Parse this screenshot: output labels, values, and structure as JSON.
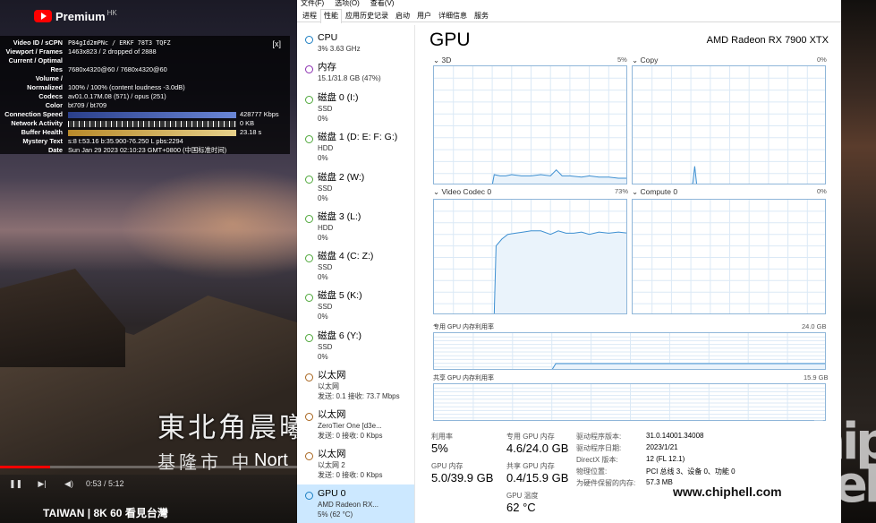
{
  "video": {
    "brand": "Premium",
    "region": "HK",
    "stats": [
      {
        "k": "Video ID / sCPN",
        "v": "P84gId2mPNc  /  ERKF  78T3  TQFZ"
      },
      {
        "k": "Viewport / Frames",
        "v": "1463x823 / 2 dropped of 2888"
      },
      {
        "k": "Current / Optimal",
        "v": ""
      },
      {
        "k": "Res",
        "v": "7680x4320@60 / 7680x4320@60"
      },
      {
        "k": "Volume /",
        "v": ""
      },
      {
        "k": "Normalized",
        "v": "100% / 100% (content loudness -3.0dB)"
      },
      {
        "k": "Codecs",
        "v": "av01.0.17M.08 (571) / opus (251)"
      },
      {
        "k": "Color",
        "v": "bt709 / bt709"
      },
      {
        "k": "Connection Speed",
        "v": "428777 Kbps"
      },
      {
        "k": "Network Activity",
        "v": "0 KB"
      },
      {
        "k": "Buffer Health",
        "v": "23.18 s"
      },
      {
        "k": "Mystery Text",
        "v": "s:8 t:53.16 b:35.900-76.250 L pbs:2294"
      },
      {
        "k": "Date",
        "v": "Sun Jan 29 2023 02:10:23 GMT+0800 (中国标准时间)"
      }
    ],
    "close_label": "[x]",
    "subtitle_cn": "東北角晨曦",
    "subtitle_city": "基隆市 中",
    "subtitle_en": "Nort",
    "time": "0:53 / 5:12",
    "progress": 0.17,
    "title": "TAIWAN | 8K 60 看見台灣"
  },
  "taskmgr": {
    "menu": [
      "文件(F)",
      "选项(O)",
      "查看(V)"
    ],
    "tabs": [
      "进程",
      "性能",
      "应用历史记录",
      "启动",
      "用户",
      "详细信息",
      "服务"
    ],
    "active_tab": 1,
    "sidebar": [
      {
        "name": "CPU",
        "sub1": "3%  3.63 GHz",
        "sub2": "",
        "color": "#1b7ec2"
      },
      {
        "name": "内存",
        "sub1": "15.1/31.8 GB (47%)",
        "sub2": "",
        "color": "#8b2fb0"
      },
      {
        "name": "磁盘 0 (I:)",
        "sub1": "SSD",
        "sub2": "0%",
        "color": "#4fa83a"
      },
      {
        "name": "磁盘 1 (D: E: F: G:)",
        "sub1": "HDD",
        "sub2": "0%",
        "color": "#4fa83a"
      },
      {
        "name": "磁盘 2 (W:)",
        "sub1": "SSD",
        "sub2": "0%",
        "color": "#4fa83a"
      },
      {
        "name": "磁盘 3 (L:)",
        "sub1": "HDD",
        "sub2": "0%",
        "color": "#4fa83a"
      },
      {
        "name": "磁盘 4 (C: Z:)",
        "sub1": "SSD",
        "sub2": "0%",
        "color": "#4fa83a"
      },
      {
        "name": "磁盘 5 (K:)",
        "sub1": "SSD",
        "sub2": "0%",
        "color": "#4fa83a"
      },
      {
        "name": "磁盘 6 (Y:)",
        "sub1": "SSD",
        "sub2": "0%",
        "color": "#4fa83a"
      },
      {
        "name": "以太网",
        "sub1": "以太网",
        "sub2": "发送: 0.1 接收: 73.7 Mbps",
        "color": "#a8651e"
      },
      {
        "name": "以太网",
        "sub1": "ZeroTier One [d3e...",
        "sub2": "发送: 0 接收: 0 Kbps",
        "color": "#a8651e"
      },
      {
        "name": "以太网",
        "sub1": "以太网 2",
        "sub2": "发送: 0 接收: 0 Kbps",
        "color": "#a8651e"
      },
      {
        "name": "GPU 0",
        "sub1": "AMD Radeon RX...",
        "sub2": "5% (62 °C)",
        "color": "#1b7ec2"
      }
    ],
    "selected": 12,
    "gpu": {
      "title": "GPU",
      "model": "AMD Radeon RX 7900 XTX",
      "engines": [
        {
          "label": "3D",
          "pct": "5%"
        },
        {
          "label": "Copy",
          "pct": "0%"
        },
        {
          "label": "Video Codec 0",
          "pct": "73%"
        },
        {
          "label": "Compute 0",
          "pct": "0%"
        }
      ],
      "dedicated_label": "专用 GPU 内存利用率",
      "dedicated_max": "24.0 GB",
      "shared_label": "共享 GPU 内存利用率",
      "shared_max": "15.9 GB",
      "stats": {
        "util_label": "利用率",
        "util": "5%",
        "ded_label": "专用 GPU 内存",
        "ded": "4.6/24.0 GB",
        "gpumem_label": "GPU 内存",
        "gpumem": "5.0/39.9 GB",
        "shared_label": "共享 GPU 内存",
        "shared": "0.4/15.9 GB",
        "temp_label": "GPU 温度",
        "temp": "62 °C"
      },
      "details": [
        {
          "k": "驱动程序版本:",
          "v": "31.0.14001.34008"
        },
        {
          "k": "驱动程序日期:",
          "v": "2023/1/21"
        },
        {
          "k": "DirectX 版本:",
          "v": "12 (FL 12.1)"
        },
        {
          "k": "物理位置:",
          "v": "PCI 总线 3、设备 0、功能 0"
        },
        {
          "k": "为硬件保留的内存:",
          "v": "57.3 MB"
        }
      ]
    }
  },
  "watermark": {
    "logo": "chip hell",
    "url": "www.chiphell.com"
  }
}
